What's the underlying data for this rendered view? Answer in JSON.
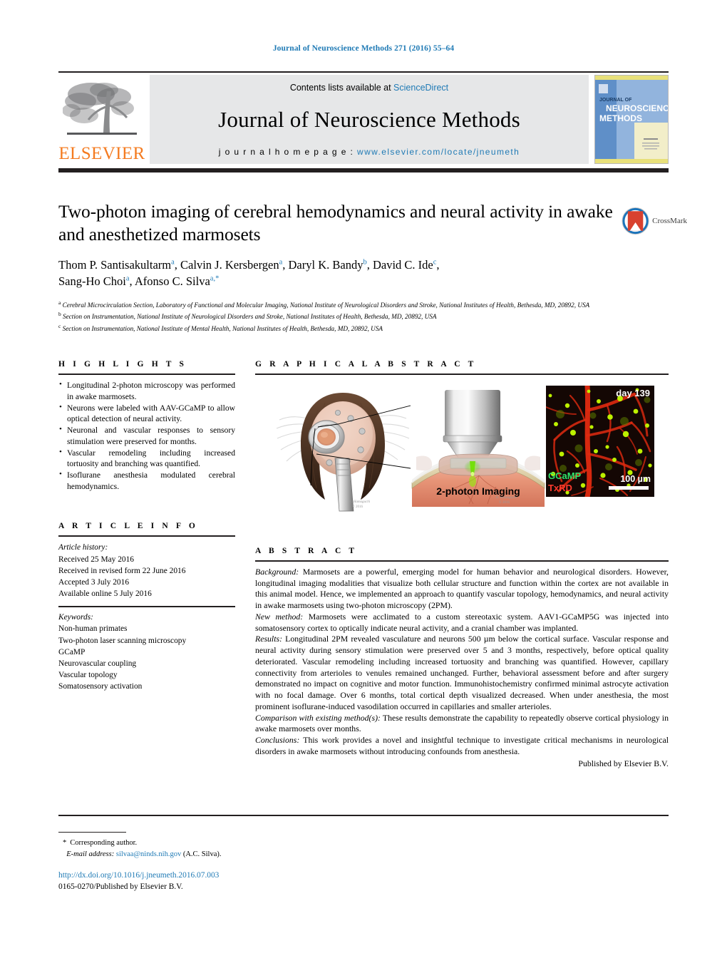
{
  "running_head": "Journal of Neuroscience Methods 271 (2016) 55–64",
  "masthead": {
    "contents_prefix": "Contents lists available at ",
    "sciencedirect": "ScienceDirect",
    "journal_title": "Journal of Neuroscience Methods",
    "homepage_prefix": "j o u r n a l   h o m e p a g e :  ",
    "homepage_url": "www.elsevier.com/locate/jneumeth",
    "publisher_logo_text": "ELSEVIER",
    "cover_line1": "JOURNAL OF",
    "cover_line2": "NEUROSCIENCE",
    "cover_line3": "METHODS",
    "accent_blue": "#1f7ab5",
    "elsevier_orange": "#f47b20"
  },
  "article": {
    "title": "Two-photon imaging of cerebral hemodynamics and neural activity in awake and anesthetized marmosets",
    "crossmark_label": "CrossMark",
    "authors_line1": "Thom P. Santisakultarm",
    "authors": [
      {
        "name": "Thom P. Santisakultarm",
        "mark": "a",
        "sep": ", "
      },
      {
        "name": "Calvin J. Kersbergen",
        "mark": "a",
        "sep": ", "
      },
      {
        "name": "Daryl K. Bandy",
        "mark": "b",
        "sep": ", "
      },
      {
        "name": "David C. Ide",
        "mark": "c",
        "sep": ","
      },
      {
        "name": "Sang-Ho Choi",
        "mark": "a",
        "sep": ", "
      },
      {
        "name": "Afonso C. Silva",
        "mark": "a,*",
        "sep": ""
      }
    ],
    "affiliations": [
      {
        "mark": "a",
        "text": "Cerebral Microcirculation Section, Laboratory of Functional and Molecular Imaging, National Institute of Neurological Disorders and Stroke, National Institutes of Health, Bethesda, MD, 20892, USA"
      },
      {
        "mark": "b",
        "text": "Section on Instrumentation, National Institute of Neurological Disorders and Stroke, National Institutes of Health, Bethesda, MD, 20892, USA"
      },
      {
        "mark": "c",
        "text": "Section on Instrumentation, National Institute of Mental Health, National Institutes of Health, Bethesda, MD, 20892, USA"
      }
    ]
  },
  "highlights": {
    "heading": "H I G H L I G H T S",
    "items": [
      "Longitudinal 2-photon microscopy was performed in awake marmosets.",
      "Neurons were labeled with AAV-GCaMP to allow optical detection of neural activity.",
      "Neuronal and vascular responses to sensory stimulation were preserved for months.",
      "Vascular remodeling including increased tortuosity and branching was quantified.",
      "Isoflurane anesthesia modulated cerebral hemodynamics."
    ]
  },
  "article_info": {
    "heading": "A R T I C L E    I N F O",
    "history_label": "Article history:",
    "history": [
      "Received 25 May 2016",
      "Received in revised form 22 June 2016",
      "Accepted 3 July 2016",
      "Available online 5 July 2016"
    ],
    "keywords_label": "Keywords:",
    "keywords": [
      "Non-human primates",
      "Two-photon laser scanning microscopy",
      "GCaMP",
      "Neurovascular coupling",
      "Vascular topology",
      "Somatosensory activation"
    ]
  },
  "graphical_abstract": {
    "heading": "G R A P H I C A L   A B S T R A C T",
    "caption": "2-photon Imaging",
    "micrograph": {
      "day_label": "day 139",
      "green_channel_label": "GCaMP",
      "red_channel_label": "TxRD",
      "scale_bar_label": "100 µm"
    }
  },
  "abstract": {
    "heading": "A B S T R A C T",
    "sections": [
      {
        "lead": "Background:",
        "text": " Marmosets are a powerful, emerging model for human behavior and neurological disorders. However, longitudinal imaging modalities that visualize both cellular structure and function within the cortex are not available in this animal model. Hence, we implemented an approach to quantify vascular topology, hemodynamics, and neural activity in awake marmosets using two-photon microscopy (2PM)."
      },
      {
        "lead": "New method:",
        "text": " Marmosets were acclimated to a custom stereotaxic system. AAV1-GCaMP5G was injected into somatosensory cortex to optically indicate neural activity, and a cranial chamber was implanted."
      },
      {
        "lead": "Results:",
        "text": " Longitudinal 2PM revealed vasculature and neurons 500 µm below the cortical surface. Vascular response and neural activity during sensory stimulation were preserved over 5 and 3 months, respectively, before optical quality deteriorated. Vascular remodeling including increased tortuosity and branching was quantified. However, capillary connectivity from arterioles to venules remained unchanged. Further, behavioral assessment before and after surgery demonstrated no impact on cognitive and motor function. Immunohistochemistry confirmed minimal astrocyte activation with no focal damage. Over 6 months, total cortical depth visualized decreased. When under anesthesia, the most prominent isoflurane-induced vasodilation occurred in capillaries and smaller arterioles."
      },
      {
        "lead": "Comparison with existing method(s):",
        "text": " These results demonstrate the capability to repeatedly observe cortical physiology in awake marmosets over months."
      },
      {
        "lead": "Conclusions:",
        "text": " This work provides a novel and insightful technique to investigate critical mechanisms in neurological disorders in awake marmosets without introducing confounds from anesthesia."
      }
    ],
    "published_by": "Published by Elsevier B.V."
  },
  "footer": {
    "corresponding_star": "*",
    "corresponding_text": "Corresponding author.",
    "email_label": "E-mail address:",
    "email": "silvaa@ninds.nih.gov",
    "email_suffix": "(A.C. Silva).",
    "doi_url": "http://dx.doi.org/10.1016/j.jneumeth.2016.07.003",
    "issn_line": "0165-0270/Published by Elsevier B.V."
  }
}
